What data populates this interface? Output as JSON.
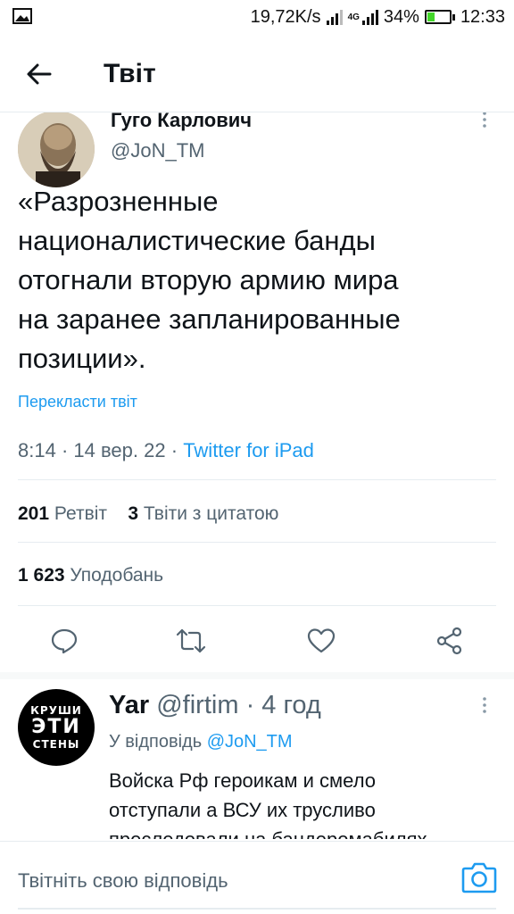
{
  "status_bar": {
    "speed": "19,72K/s",
    "network_4g": "4G",
    "battery_percent": "34%",
    "battery_level": 0.34,
    "time": "12:33"
  },
  "header": {
    "title": "Твіт"
  },
  "tweet": {
    "author_name": "Гуго Карлович",
    "author_handle": "@JoN_TM",
    "text": "«Разрозненные\nнационалистические банды\nотогнали вторую армию мира\nна заранее запланированные\nпозиции».",
    "translate_label": "Перекласти твіт",
    "time": "8:14",
    "date": "14 вер. 22",
    "client": "Twitter for iPad",
    "retweets_count": "201",
    "retweets_label": "Ретвіт",
    "quotes_count": "3",
    "quotes_label": "Твіти з цитатою",
    "likes_count": "1 623",
    "likes_label": "Уподобань"
  },
  "reply": {
    "avatar_lines": [
      "КРУШИ",
      "ЭТИ",
      "СТЕНЫ"
    ],
    "name": "Yar",
    "handle": "@firtim",
    "time": "4 год",
    "reply_prefix": "У відповідь",
    "reply_mention": "@JoN_TM",
    "text": "Войска Рф героикам и смело\nотступали а ВСУ их трусливо\nпреследовали на бандеромабилях"
  },
  "compose": {
    "placeholder": "Твітніть свою відповідь"
  },
  "colors": {
    "accent": "#1d9bf0",
    "secondary_text": "#536471",
    "battery_fill": "#43d62a"
  },
  "icons": [
    "image-icon",
    "signal-icon",
    "battery-icon",
    "back-arrow-icon",
    "more-icon",
    "reply-icon",
    "retweet-icon",
    "like-icon",
    "share-icon",
    "camera-icon"
  ]
}
